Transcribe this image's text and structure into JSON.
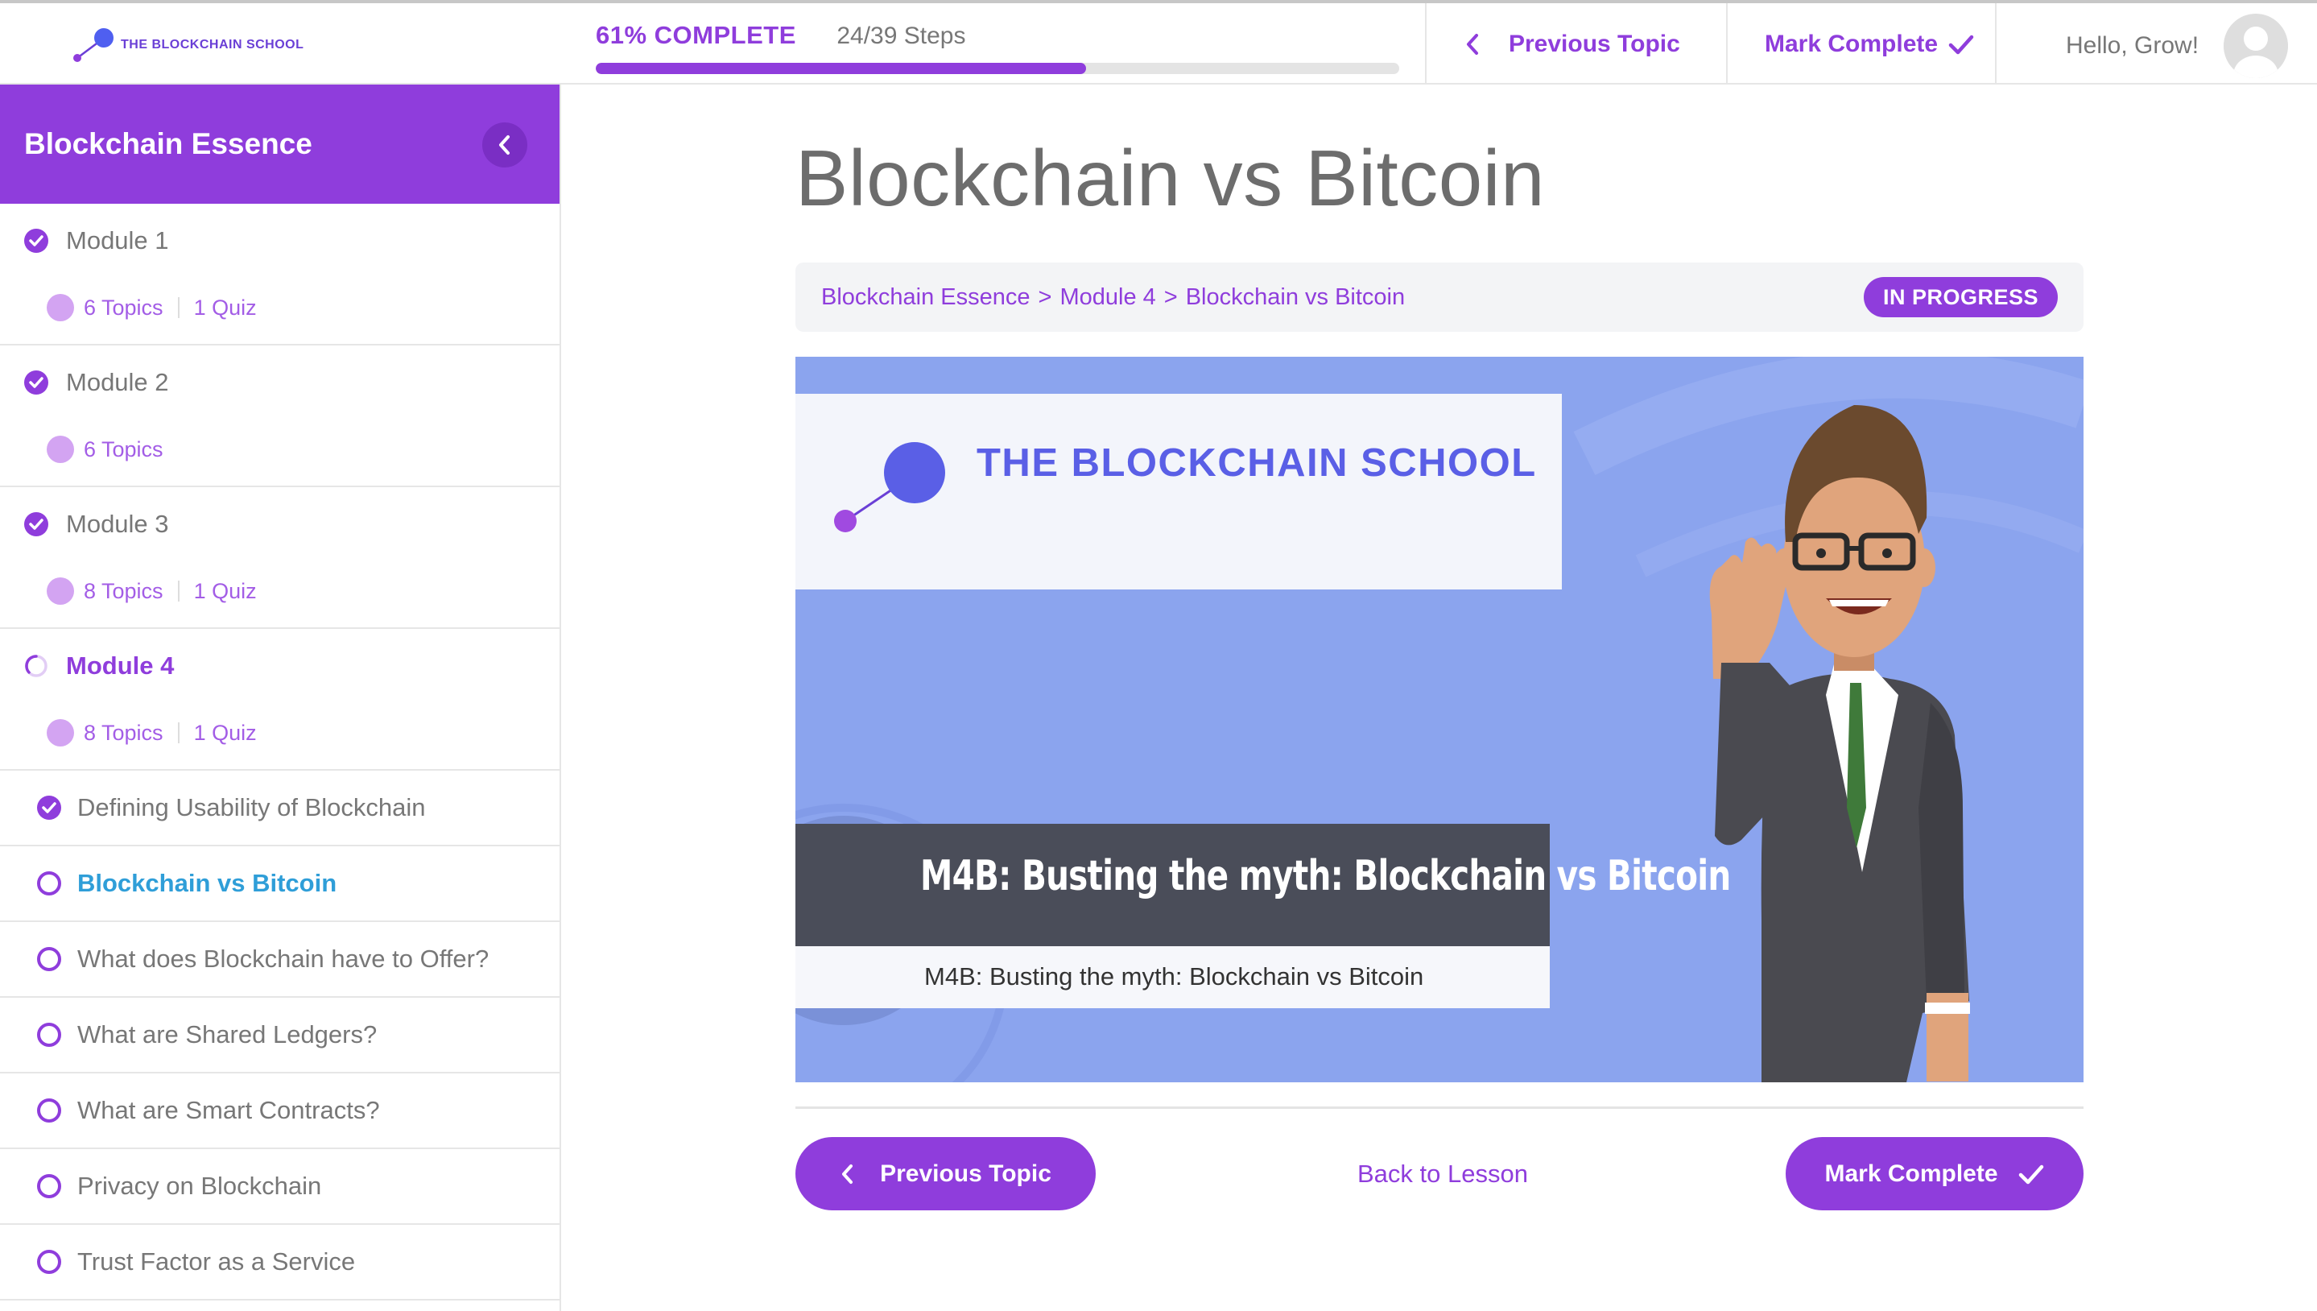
{
  "header": {
    "logo_text": "THE BLOCKCHAIN SCHOOL",
    "progress_label": "61% COMPLETE",
    "progress_fraction": 0.61,
    "steps_label": "24/39 Steps",
    "previous_topic": "Previous Topic",
    "mark_complete": "Mark Complete",
    "greeting": "Hello, Grow!"
  },
  "sidebar": {
    "course_title": "Blockchain Essence",
    "modules": [
      {
        "name": "Module 1",
        "status": "complete",
        "topics": "6 Topics",
        "quiz": "1 Quiz"
      },
      {
        "name": "Module 2",
        "status": "complete",
        "topics": "6 Topics",
        "quiz": ""
      },
      {
        "name": "Module 3",
        "status": "complete",
        "topics": "8 Topics",
        "quiz": "1 Quiz"
      },
      {
        "name": "Module 4",
        "status": "in-progress",
        "topics": "8 Topics",
        "quiz": "1 Quiz"
      }
    ],
    "topics": [
      {
        "label": "Defining Usability of Blockchain",
        "status": "complete"
      },
      {
        "label": "Blockchain vs Bitcoin",
        "status": "current"
      },
      {
        "label": "What does Blockchain have to Offer?",
        "status": "incomplete"
      },
      {
        "label": "What are Shared Ledgers?",
        "status": "incomplete"
      },
      {
        "label": "What are Smart Contracts?",
        "status": "incomplete"
      },
      {
        "label": "Privacy on Blockchain",
        "status": "incomplete"
      },
      {
        "label": "Trust Factor as a Service",
        "status": "incomplete"
      }
    ]
  },
  "main": {
    "title": "Blockchain vs Bitcoin",
    "breadcrumb": [
      "Blockchain Essence",
      "Module 4",
      "Blockchain vs Bitcoin"
    ],
    "breadcrumb_separator": ">",
    "status_badge": "IN PROGRESS",
    "video": {
      "logo_text": "THE BLOCKCHAIN SCHOOL",
      "caption_title": "M4B: Busting the myth: Blockchain vs Bitcoin",
      "caption_subtitle": "M4B: Busting the myth: Blockchain vs Bitcoin"
    },
    "previous_topic": "Previous Topic",
    "back_to_lesson": "Back to Lesson",
    "mark_complete": "Mark Complete"
  },
  "colors": {
    "accent": "#8f3ddc",
    "link_current": "#2f9ed8",
    "video_bg": "#8ba4ee"
  }
}
